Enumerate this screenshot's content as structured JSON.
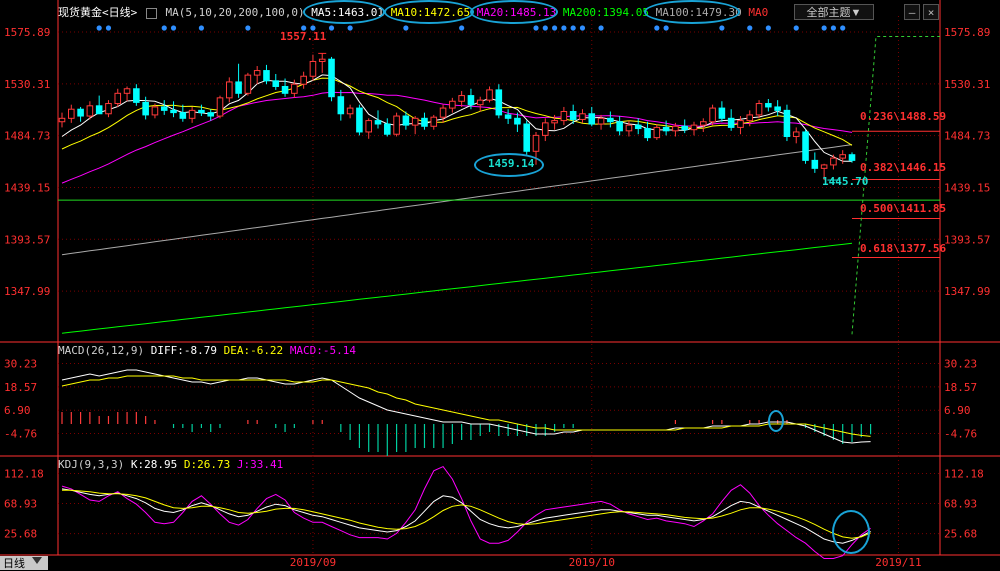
{
  "header": {
    "instrument": "现货黄金",
    "period": "<日线>",
    "ma_params": "MA(5,10,20,200,100,0)",
    "ma5": "MA5:1463.01",
    "ma10": "MA10:1472.65",
    "ma20": "MA20:1485.13",
    "ma200": "MA200:1394.05",
    "ma100": "MA100:1479.30",
    "ma0": "MA0",
    "theme_button": "全部主题▼",
    "win_min": "—",
    "win_close": "×"
  },
  "macd_header": {
    "params": "MACD(26,12,9)",
    "diff": "DIFF:-8.79",
    "dea": "DEA:-6.22",
    "macd": "MACD:-5.14"
  },
  "kdj_header": {
    "params": "KDJ(9,3,3)",
    "k": "K:28.95",
    "d": "D:26.73",
    "j": "J:33.41"
  },
  "annotations": {
    "high": "1557.11",
    "low_sep": "1459.14",
    "recent_low": "1445.70"
  },
  "fibonacci": [
    {
      "label": "0.236\\1488.59",
      "price": 1488.59
    },
    {
      "label": "0.382\\1446.15",
      "price": 1446.15
    },
    {
      "label": "0.500\\1411.85",
      "price": 1411.85
    },
    {
      "label": "0.618\\1377.56",
      "price": 1377.56
    }
  ],
  "footer": {
    "tab": "日线"
  },
  "colors": {
    "up": "#ff3a3a",
    "down": "#00ffff",
    "ma5": "#ffffff",
    "ma10": "#ffff00",
    "ma20": "#ff00ff",
    "ma200": "#00ff00",
    "ma100": "#aaaaaa",
    "axis": "#ff3030",
    "grid": "#7a0000",
    "ellipse": "#19a3d6"
  },
  "chart_data": [
    {
      "type": "candlestick",
      "title": "现货黄金 日线",
      "y_ticks": [
        1575.89,
        1530.31,
        1484.73,
        1439.15,
        1393.57,
        1347.99
      ],
      "ylim": [
        1305,
        1590
      ],
      "x_labels": [
        {
          "label": "2019/09",
          "index": 27
        },
        {
          "label": "2019/10",
          "index": 57
        },
        {
          "label": "2019/11",
          "index": 90
        }
      ],
      "ohlc": [
        [
          1497,
          1505,
          1492,
          1500
        ],
        [
          1500,
          1512,
          1496,
          1508
        ],
        [
          1508,
          1510,
          1497,
          1502
        ],
        [
          1502,
          1515,
          1499,
          1511
        ],
        [
          1511,
          1520,
          1506,
          1504
        ],
        [
          1504,
          1516,
          1501,
          1513
        ],
        [
          1513,
          1526,
          1510,
          1522
        ],
        [
          1522,
          1528,
          1515,
          1526
        ],
        [
          1526,
          1530,
          1511,
          1514
        ],
        [
          1514,
          1519,
          1499,
          1503
        ],
        [
          1503,
          1513,
          1500,
          1510
        ],
        [
          1510,
          1516,
          1503,
          1507
        ],
        [
          1507,
          1515,
          1501,
          1505
        ],
        [
          1505,
          1512,
          1497,
          1500
        ],
        [
          1500,
          1510,
          1496,
          1507
        ],
        [
          1507,
          1512,
          1502,
          1505
        ],
        [
          1505,
          1508,
          1498,
          1502
        ],
        [
          1502,
          1520,
          1500,
          1518
        ],
        [
          1518,
          1536,
          1514,
          1532
        ],
        [
          1532,
          1548,
          1518,
          1522
        ],
        [
          1522,
          1540,
          1520,
          1538
        ],
        [
          1538,
          1546,
          1530,
          1542
        ],
        [
          1542,
          1547,
          1530,
          1533
        ],
        [
          1533,
          1539,
          1525,
          1528
        ],
        [
          1528,
          1535,
          1519,
          1522
        ],
        [
          1522,
          1534,
          1518,
          1530
        ],
        [
          1530,
          1541,
          1526,
          1537
        ],
        [
          1537,
          1556,
          1533,
          1550
        ],
        [
          1550,
          1557.11,
          1540,
          1552
        ],
        [
          1552,
          1554,
          1515,
          1519
        ],
        [
          1519,
          1525,
          1498,
          1504
        ],
        [
          1504,
          1512,
          1500,
          1509
        ],
        [
          1509,
          1512,
          1485,
          1488
        ],
        [
          1488,
          1500,
          1482,
          1498
        ],
        [
          1498,
          1507,
          1491,
          1495
        ],
        [
          1495,
          1500,
          1484,
          1486
        ],
        [
          1486,
          1505,
          1484,
          1502
        ],
        [
          1502,
          1506,
          1490,
          1494
        ],
        [
          1494,
          1502,
          1486,
          1500
        ],
        [
          1500,
          1505,
          1490,
          1493
        ],
        [
          1493,
          1503,
          1490,
          1501
        ],
        [
          1501,
          1512,
          1496,
          1509
        ],
        [
          1509,
          1518,
          1505,
          1515
        ],
        [
          1515,
          1524,
          1510,
          1520
        ],
        [
          1520,
          1526,
          1508,
          1512
        ],
        [
          1512,
          1519,
          1506,
          1516
        ],
        [
          1516,
          1528,
          1514,
          1525
        ],
        [
          1525,
          1530,
          1500,
          1503
        ],
        [
          1503,
          1508,
          1495,
          1500
        ],
        [
          1500,
          1505,
          1488,
          1495
        ],
        [
          1495,
          1498,
          1468,
          1471
        ],
        [
          1471,
          1488,
          1459.14,
          1485
        ],
        [
          1485,
          1500,
          1480,
          1496
        ],
        [
          1496,
          1503,
          1490,
          1498
        ],
        [
          1498,
          1510,
          1494,
          1506
        ],
        [
          1506,
          1512,
          1495,
          1499
        ],
        [
          1499,
          1508,
          1496,
          1504
        ],
        [
          1504,
          1510,
          1493,
          1495
        ],
        [
          1495,
          1503,
          1490,
          1500
        ],
        [
          1500,
          1506,
          1492,
          1497
        ],
        [
          1497,
          1502,
          1485,
          1489
        ],
        [
          1489,
          1498,
          1484,
          1494
        ],
        [
          1494,
          1500,
          1486,
          1491
        ],
        [
          1491,
          1497,
          1480,
          1483
        ],
        [
          1483,
          1495,
          1481,
          1492
        ],
        [
          1492,
          1498,
          1485,
          1489
        ],
        [
          1489,
          1496,
          1484,
          1493
        ],
        [
          1493,
          1499,
          1487,
          1490
        ],
        [
          1490,
          1497,
          1485,
          1494
        ],
        [
          1494,
          1500,
          1488,
          1497
        ],
        [
          1497,
          1512,
          1494,
          1509
        ],
        [
          1509,
          1515,
          1497,
          1500
        ],
        [
          1500,
          1508,
          1489,
          1492
        ],
        [
          1492,
          1502,
          1486,
          1498
        ],
        [
          1498,
          1507,
          1493,
          1503
        ],
        [
          1503,
          1516,
          1500,
          1513
        ],
        [
          1513,
          1517,
          1506,
          1510
        ],
        [
          1510,
          1516,
          1502,
          1507
        ],
        [
          1507,
          1512,
          1480,
          1484
        ],
        [
          1484,
          1492,
          1478,
          1488
        ],
        [
          1488,
          1490,
          1460,
          1463
        ],
        [
          1463,
          1470,
          1452,
          1456
        ],
        [
          1456,
          1460,
          1445.7,
          1459
        ],
        [
          1459,
          1468,
          1455,
          1465
        ],
        [
          1465,
          1472,
          1460,
          1468
        ],
        [
          1468,
          1470,
          1461,
          1463
        ]
      ],
      "series": [
        {
          "name": "MA5",
          "last": 1463.01
        },
        {
          "name": "MA10",
          "last": 1472.65
        },
        {
          "name": "MA20",
          "last": 1485.13
        },
        {
          "name": "MA200",
          "last": 1394.05
        },
        {
          "name": "MA100",
          "last": 1479.3
        }
      ]
    },
    {
      "type": "macd",
      "title": "MACD(26,12,9)",
      "y_ticks": [
        30.23,
        18.57,
        6.9,
        -4.76
      ],
      "ylim": [
        -15,
        35
      ],
      "diff": [
        22,
        23,
        24,
        25,
        24,
        25,
        26,
        27,
        27,
        26,
        25,
        24,
        23,
        22,
        21,
        21,
        20,
        21,
        22,
        22,
        23,
        23,
        22,
        21,
        20,
        20,
        21,
        22,
        23,
        22,
        19,
        16,
        13,
        11,
        9,
        7,
        6,
        5,
        4,
        3,
        2,
        1,
        1,
        1,
        0,
        0,
        0,
        -1,
        -2,
        -3,
        -4,
        -5,
        -5,
        -5,
        -4,
        -4,
        -3,
        -3,
        -3,
        -3,
        -3,
        -3,
        -3,
        -3,
        -3,
        -3,
        -2,
        -2,
        -2,
        -2,
        -1,
        -1,
        -1,
        -1,
        0,
        0,
        1,
        1,
        1,
        0,
        -1,
        -3,
        -5,
        -7,
        -9,
        -9.5,
        -9,
        -8.79
      ],
      "dea": [
        19,
        20,
        21,
        22,
        22,
        23,
        23,
        24,
        24,
        24,
        24,
        24,
        24,
        23,
        23,
        22,
        22,
        22,
        22,
        22,
        22,
        22,
        22,
        22,
        22,
        21,
        21,
        21,
        22,
        22,
        21,
        20,
        19,
        18,
        16,
        15,
        13,
        12,
        10,
        9,
        8,
        7,
        6,
        5,
        4,
        3,
        2,
        2,
        1,
        0,
        -1,
        -2,
        -2,
        -3,
        -3,
        -3,
        -3,
        -3,
        -3,
        -3,
        -3,
        -3,
        -3,
        -3,
        -3,
        -3,
        -3,
        -2,
        -2,
        -2,
        -2,
        -2,
        -1,
        -1,
        -1,
        -1,
        0,
        0,
        0,
        0,
        0,
        -1,
        -2,
        -3,
        -4,
        -5,
        -5.7,
        -6.22
      ],
      "macd": [
        6,
        6,
        6,
        6,
        4,
        4,
        6,
        6,
        6,
        4,
        2,
        0,
        -2,
        -2,
        -4,
        -2,
        -4,
        -2,
        0,
        0,
        2,
        2,
        0,
        -2,
        -4,
        -2,
        0,
        2,
        2,
        0,
        -4,
        -8,
        -12,
        -14,
        -14,
        -16,
        -14,
        -14,
        -12,
        -12,
        -12,
        -12,
        -10,
        -8,
        -8,
        -6,
        -4,
        -6,
        -6,
        -6,
        -6,
        -6,
        -6,
        -4,
        -2,
        -2,
        0,
        0,
        0,
        0,
        0,
        0,
        0,
        0,
        0,
        0,
        2,
        0,
        0,
        0,
        2,
        2,
        0,
        0,
        2,
        2,
        2,
        2,
        2,
        0,
        -2,
        -4,
        -6,
        -8,
        -10,
        -9,
        -6.6,
        -5.14
      ]
    },
    {
      "type": "kdj",
      "title": "KDJ(9,3,3)",
      "y_ticks": [
        112.18,
        68.93,
        25.68
      ],
      "ylim": [
        -5,
        120
      ],
      "k": [
        90,
        88,
        85,
        82,
        80,
        82,
        84,
        80,
        76,
        70,
        62,
        58,
        56,
        60,
        66,
        70,
        66,
        60,
        54,
        50,
        52,
        58,
        64,
        68,
        66,
        60,
        56,
        52,
        50,
        46,
        42,
        38,
        34,
        32,
        30,
        28,
        30,
        36,
        44,
        58,
        72,
        80,
        78,
        70,
        58,
        46,
        40,
        36,
        34,
        36,
        40,
        44,
        48,
        50,
        52,
        54,
        56,
        58,
        60,
        60,
        58,
        56,
        54,
        52,
        52,
        50,
        48,
        46,
        44,
        46,
        50,
        58,
        66,
        72,
        70,
        64,
        58,
        52,
        46,
        40,
        34,
        26,
        18,
        14,
        12,
        16,
        22,
        28.95
      ],
      "d": [
        88,
        88,
        87,
        86,
        84,
        83,
        83,
        82,
        80,
        77,
        72,
        67,
        63,
        62,
        63,
        65,
        65,
        63,
        60,
        56,
        55,
        56,
        58,
        61,
        62,
        62,
        60,
        57,
        54,
        51,
        48,
        45,
        41,
        38,
        35,
        33,
        32,
        33,
        36,
        42,
        50,
        59,
        65,
        67,
        65,
        60,
        54,
        48,
        43,
        40,
        39,
        40,
        42,
        44,
        46,
        48,
        50,
        52,
        54,
        56,
        57,
        57,
        56,
        55,
        54,
        53,
        51,
        49,
        48,
        47,
        48,
        51,
        55,
        60,
        63,
        63,
        61,
        58,
        54,
        50,
        45,
        39,
        32,
        26,
        21,
        19,
        21,
        26.73
      ],
      "j": [
        94,
        90,
        82,
        74,
        72,
        80,
        86,
        76,
        68,
        56,
        42,
        40,
        42,
        56,
        72,
        80,
        68,
        54,
        42,
        38,
        46,
        62,
        76,
        82,
        74,
        56,
        48,
        42,
        42,
        36,
        30,
        24,
        20,
        20,
        20,
        18,
        26,
        42,
        60,
        90,
        116,
        122,
        104,
        76,
        44,
        18,
        12,
        12,
        16,
        28,
        42,
        52,
        60,
        62,
        64,
        66,
        68,
        70,
        72,
        68,
        60,
        54,
        50,
        46,
        48,
        44,
        42,
        40,
        36,
        44,
        54,
        72,
        88,
        96,
        84,
        66,
        52,
        40,
        30,
        20,
        12,
        0,
        -10,
        -10,
        -6,
        10,
        24,
        33.41
      ]
    }
  ]
}
